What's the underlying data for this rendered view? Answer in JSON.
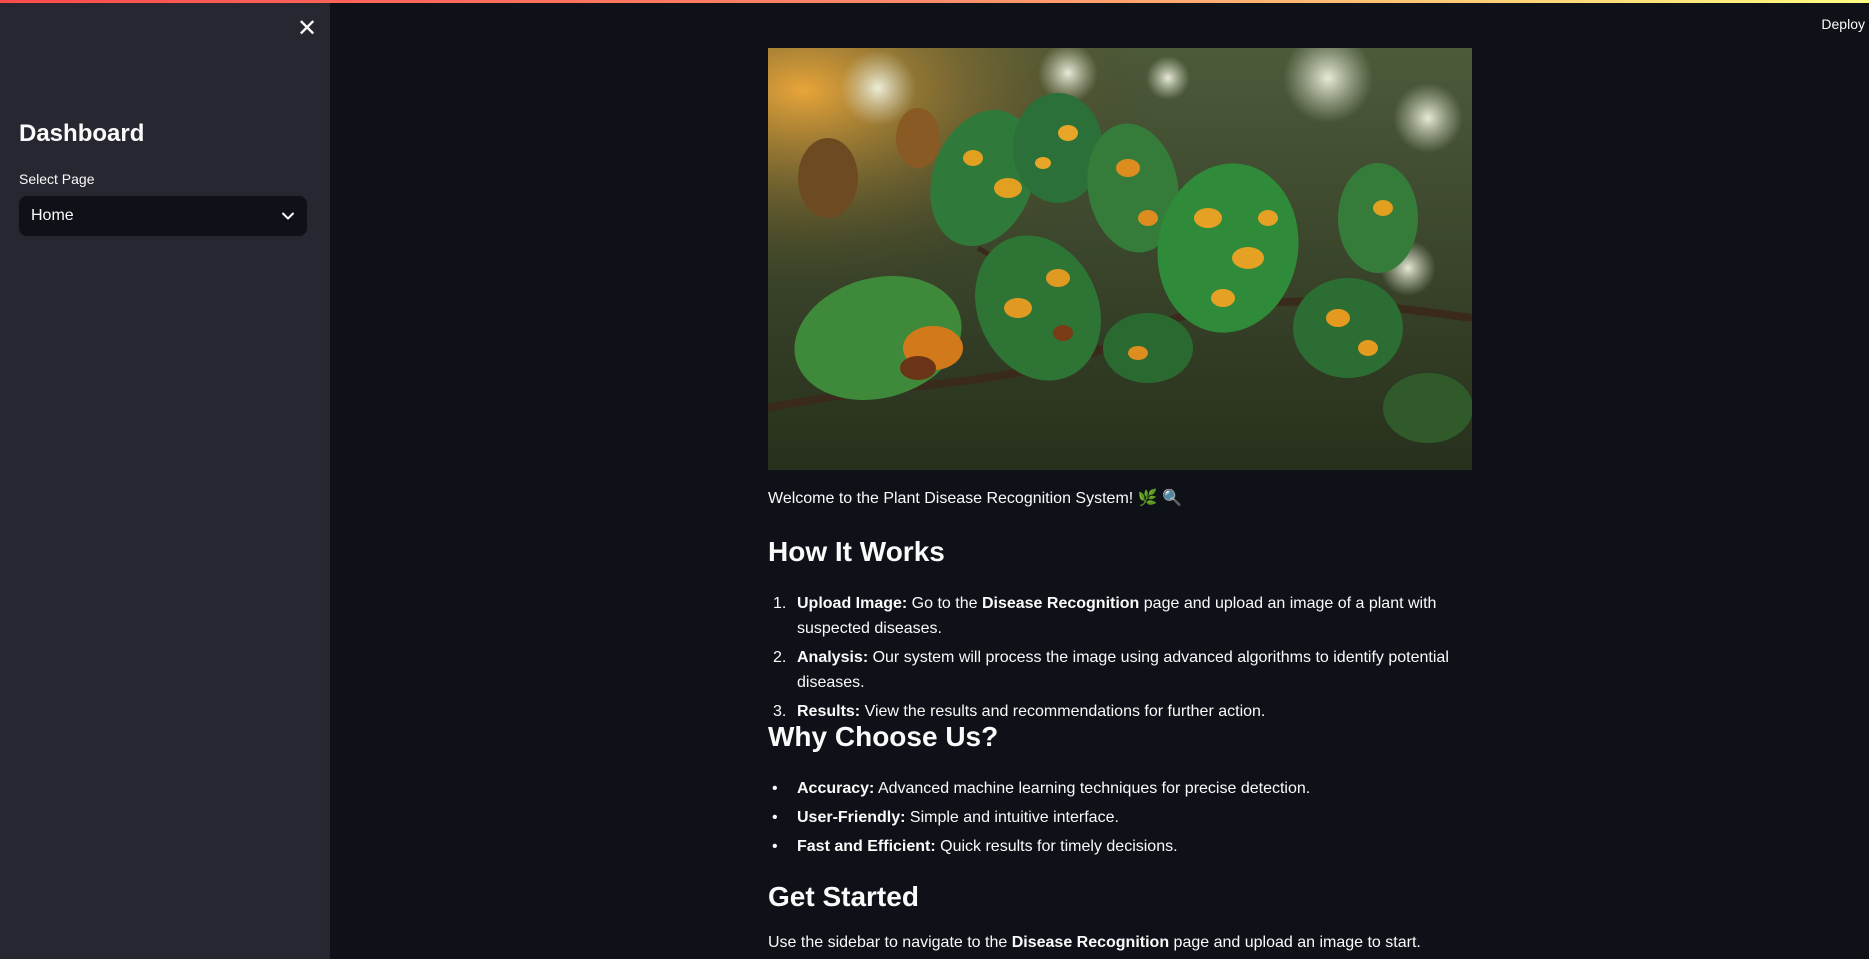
{
  "sidebar": {
    "close_icon": "close-icon",
    "title": "Dashboard",
    "select_label": "Select Page",
    "select_value": "Home"
  },
  "header": {
    "deploy_label": "Deploy"
  },
  "main": {
    "hero_image": "plant leaves with orange disease spots",
    "welcome_text": "Welcome to the Plant Disease Recognition System!",
    "welcome_emojis": [
      "🌿",
      "🔍"
    ],
    "how_heading": "How It Works",
    "how_steps": [
      {
        "num": "1.",
        "bold": "Upload Image:",
        "pre": " Go to the ",
        "link": "Disease Recognition",
        "post": " page and upload an image of a plant with suspected diseases."
      },
      {
        "num": "2.",
        "bold": "Analysis:",
        "text": " Our system will process the image using advanced algorithms to identify potential diseases."
      },
      {
        "num": "3.",
        "bold": "Results:",
        "text": " View the results and recommendations for further action."
      }
    ],
    "why_heading": "Why Choose Us?",
    "why_items": [
      {
        "bold": "Accuracy:",
        "text": " Advanced machine learning techniques for precise detection."
      },
      {
        "bold": "User-Friendly:",
        "text": " Simple and intuitive interface."
      },
      {
        "bold": "Fast and Efficient:",
        "text": " Quick results for timely decisions."
      }
    ],
    "started_heading": "Get Started",
    "started_pre": "Use the sidebar to navigate to the ",
    "started_bold": "Disease Recognition",
    "started_post": " page and upload an image to start."
  },
  "colors": {
    "background": "#0e1117",
    "sidebar": "#262730",
    "text": "#fafafa"
  }
}
